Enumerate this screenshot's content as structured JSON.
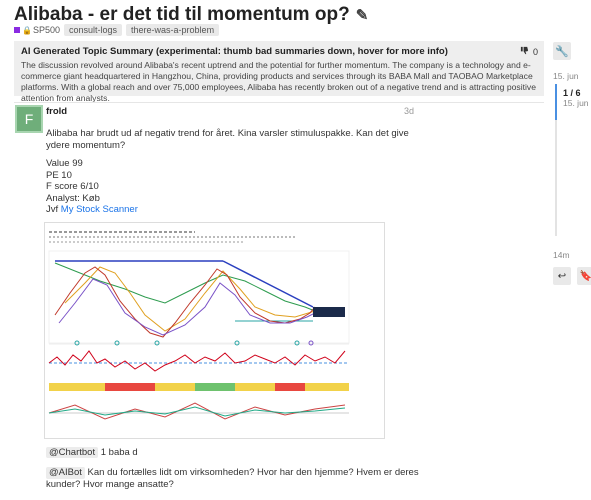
{
  "topic": {
    "title": "Alibaba - er det tid til momentum op?",
    "category": "SP500",
    "tags": [
      "consult-logs",
      "there-was-a-problem"
    ]
  },
  "summary": {
    "heading": "AI Generated Topic Summary (experimental: thumb bad summaries down, hover for more info)",
    "text": "The discussion revolved around Alibaba's recent uptrend and the potential for further momentum. The company is a technology and e-commerce giant headquartered in Hangzhou, China, providing products and services through its BABA Mall and TAOBAO Marketplace platforms. With a global reach and over 75,000 employees, Alibaba has recently broken out of a negative trend and is attracting positive attention from analysts.",
    "thumb_count": "0"
  },
  "timeline": {
    "start_date": "15. jun",
    "position": "1 / 6",
    "position_date": "15. jun",
    "end_label": "14m"
  },
  "post": {
    "author": "frold",
    "avatar_letter": "F",
    "age": "3d",
    "intro": "Alibaba har brudt ud af negativ trend for året. Kina varsler stimuluspakke. Kan det give ydere momentum?",
    "stats": [
      "Value 99",
      "PE 10",
      "F score 6/10",
      "Analyst: Køb"
    ],
    "jvf_prefix": "Jvf ",
    "jvf_link": "My Stock Scanner",
    "chatbot_mention": "@Chartbot",
    "chatbot_text": "1 baba d",
    "aibot_mention": "@AIBot",
    "aibot_text": "Kan du fortælles lidt om virksomheden? Hvor har den hjemme? Hvem er deres kunder? Hvor mange ansatte?"
  },
  "icons": {
    "edit": "pencil-icon",
    "thumb": "thumbs-down-icon",
    "admin": "wrench-icon",
    "reply": "reply-icon",
    "bookmark": "bookmark-icon"
  },
  "colors": {
    "category": "#8a2be2",
    "link": "#1a73e8",
    "avatar": "#6fae7a",
    "timeline_handle": "#4a90e2"
  }
}
